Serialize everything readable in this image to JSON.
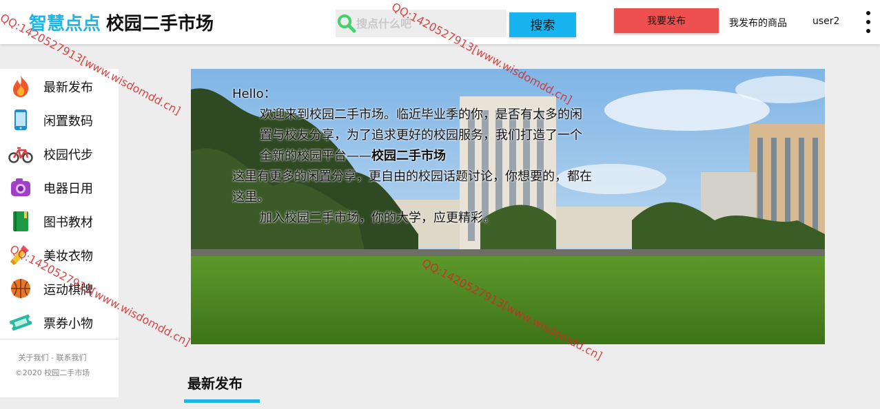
{
  "header": {
    "brand_part1": "智慧点点",
    "brand_part2": "校园二手市场",
    "search_placeholder": "搜点什么吧",
    "search_button": "搜索",
    "publish_button": "我要发布",
    "my_items_link": "我发布的商品",
    "username": "user2"
  },
  "sidebar": {
    "items": [
      {
        "label": "最新发布",
        "icon": "fire-icon"
      },
      {
        "label": "闲置数码",
        "icon": "phone-icon"
      },
      {
        "label": "校园代步",
        "icon": "bicycle-icon"
      },
      {
        "label": "电器日用",
        "icon": "camera-icon"
      },
      {
        "label": "图书教材",
        "icon": "book-icon"
      },
      {
        "label": "美妆衣物",
        "icon": "lipstick-icon"
      },
      {
        "label": "运动棋牌",
        "icon": "basketball-icon"
      },
      {
        "label": "票券小物",
        "icon": "ticket-icon"
      }
    ],
    "footer_links": "关于我们 - 联系我们",
    "copyright": "©2020 校园二手市场"
  },
  "banner": {
    "greeting": "Hello：",
    "para1_text": "欢迎来到校园二手市场。临近毕业季的你，是否有太多的闲置与校友分享，为了追求更好的校园服务，我们打造了一个全新的校园平台——",
    "para1_bold": "校园二手市场",
    "para2": "这里有更多的闲置分享，更自由的校园话题讨论，你想要的，都在这里。",
    "para3": "加入校园二手市场，你的大学，应更精彩。"
  },
  "section": {
    "title": "最新发布"
  },
  "watermark": {
    "text": "QQ:1420527913[www.wisdomdd.cn]"
  },
  "colors": {
    "accent": "#1fb6e6",
    "publish": "#ee5050",
    "search_button": "#18b4f0"
  }
}
